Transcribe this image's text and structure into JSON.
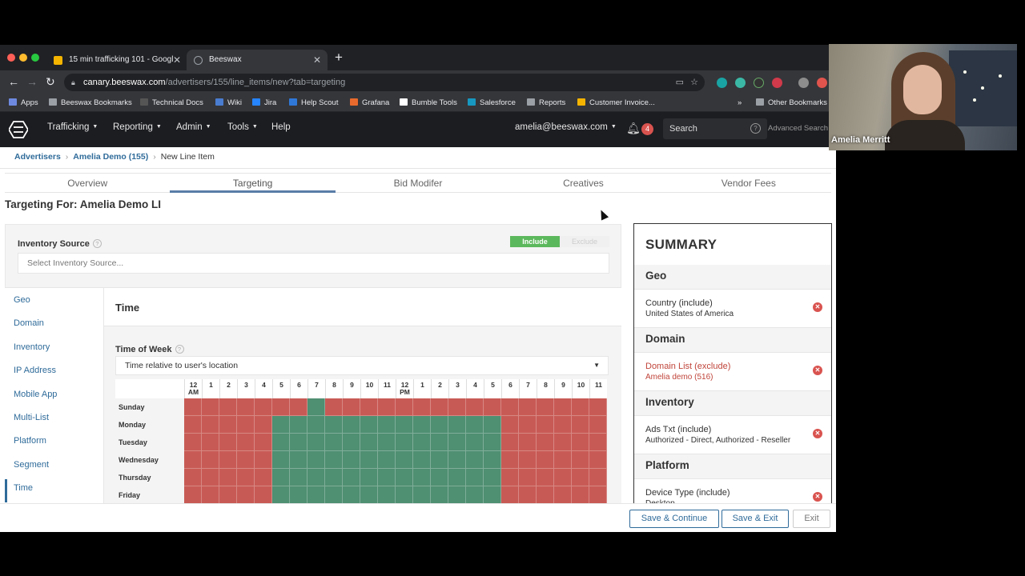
{
  "browser": {
    "tabs": [
      {
        "title": "15 min trafficking 101 - Googl",
        "active": false,
        "favicon_color": "#f4b400"
      },
      {
        "title": "Beeswax",
        "active": true,
        "favicon_color": "#9aa0a6"
      }
    ],
    "url_host": "canary.beeswax.com",
    "url_path": "/advertisers/155/line_items/new?tab=targeting",
    "bookmarks": [
      {
        "label": "Apps",
        "icon": "apps-grid-icon"
      },
      {
        "label": "Beeswax Bookmarks",
        "icon": "folder-icon"
      },
      {
        "label": "Technical Docs",
        "icon": "docs-icon"
      },
      {
        "label": "Wiki",
        "icon": "wiki-icon"
      },
      {
        "label": "Jira",
        "icon": "jira-icon"
      },
      {
        "label": "Help Scout",
        "icon": "helpscout-icon"
      },
      {
        "label": "Grafana",
        "icon": "grafana-icon"
      },
      {
        "label": "Bumble Tools",
        "icon": "google-icon"
      },
      {
        "label": "Salesforce",
        "icon": "salesforce-icon"
      },
      {
        "label": "Reports",
        "icon": "folder-icon"
      },
      {
        "label": "Customer Invoice...",
        "icon": "drive-icon"
      }
    ],
    "more_bookmarks": "»",
    "other_bookmarks": "Other Bookmarks"
  },
  "app": {
    "nav": [
      {
        "label": "Trafficking",
        "dropdown": true
      },
      {
        "label": "Reporting",
        "dropdown": true
      },
      {
        "label": "Admin",
        "dropdown": true
      },
      {
        "label": "Tools",
        "dropdown": true
      },
      {
        "label": "Help",
        "dropdown": false
      }
    ],
    "user_email": "amelia@beeswax.com",
    "notification_count": "4",
    "search_label": "Search",
    "advanced_search": "Advanced Search"
  },
  "breadcrumb": {
    "advertisers": "Advertisers",
    "advertiser": "Amelia Demo (155)",
    "current": "New Line Item"
  },
  "tabs": [
    "Overview",
    "Targeting",
    "Bid Modifer",
    "Creatives",
    "Vendor Fees"
  ],
  "active_tab": 1,
  "targeting_for": "Targeting For: Amelia Demo LI",
  "inventory_source": {
    "label": "Inventory Source",
    "include": "Include",
    "exclude": "Exclude",
    "placeholder": "Select Inventory Source..."
  },
  "left_nav": [
    "Geo",
    "Domain",
    "Inventory",
    "IP Address",
    "Mobile App",
    "Multi-List",
    "Platform",
    "Segment",
    "Time"
  ],
  "time": {
    "title": "Time",
    "time_of_week_label": "Time of Week",
    "relative_select": "Time relative to user's location",
    "hours": [
      [
        "12",
        "AM"
      ],
      [
        "1",
        ""
      ],
      [
        "2",
        ""
      ],
      [
        "3",
        ""
      ],
      [
        "4",
        ""
      ],
      [
        "5",
        ""
      ],
      [
        "6",
        ""
      ],
      [
        "7",
        ""
      ],
      [
        "8",
        ""
      ],
      [
        "9",
        ""
      ],
      [
        "10",
        ""
      ],
      [
        "11",
        ""
      ],
      [
        "12",
        "PM"
      ],
      [
        "1",
        ""
      ],
      [
        "2",
        ""
      ],
      [
        "3",
        ""
      ],
      [
        "4",
        ""
      ],
      [
        "5",
        ""
      ],
      [
        "6",
        ""
      ],
      [
        "7",
        ""
      ],
      [
        "8",
        ""
      ],
      [
        "9",
        ""
      ],
      [
        "10",
        ""
      ],
      [
        "11",
        ""
      ]
    ],
    "days": [
      {
        "name": "Sunday",
        "active_hours": [
          7
        ]
      },
      {
        "name": "Monday",
        "active_hours": [
          5,
          6,
          7,
          8,
          9,
          10,
          11,
          12,
          13,
          14,
          15,
          16,
          17
        ]
      },
      {
        "name": "Tuesday",
        "active_hours": [
          5,
          6,
          7,
          8,
          9,
          10,
          11,
          12,
          13,
          14,
          15,
          16,
          17
        ]
      },
      {
        "name": "Wednesday",
        "active_hours": [
          5,
          6,
          7,
          8,
          9,
          10,
          11,
          12,
          13,
          14,
          15,
          16,
          17
        ]
      },
      {
        "name": "Thursday",
        "active_hours": [
          5,
          6,
          7,
          8,
          9,
          10,
          11,
          12,
          13,
          14,
          15,
          16,
          17
        ]
      },
      {
        "name": "Friday",
        "active_hours": [
          5,
          6,
          7,
          8,
          9,
          10,
          11,
          12,
          13,
          14,
          15,
          16,
          17
        ]
      }
    ],
    "on_color": "#4f8f72",
    "off_color": "#c85a55"
  },
  "summary": {
    "title": "SUMMARY",
    "sections": [
      {
        "heading": "Geo",
        "title": "Country (include)",
        "value": "United States of America",
        "excluded": false
      },
      {
        "heading": "Domain",
        "title": "Domain List (exclude)",
        "value": "Amelia demo (516)",
        "excluded": true
      },
      {
        "heading": "Inventory",
        "title": "Ads Txt (include)",
        "value": "Authorized - Direct, Authorized - Reseller",
        "excluded": false
      },
      {
        "heading": "Platform",
        "title": "Device Type (include)",
        "value": "Desktop",
        "excluded": false
      }
    ]
  },
  "footer": {
    "save_continue": "Save & Continue",
    "save_exit": "Save & Exit",
    "exit": "Exit"
  },
  "webcam": {
    "name": "Amelia Merritt"
  }
}
